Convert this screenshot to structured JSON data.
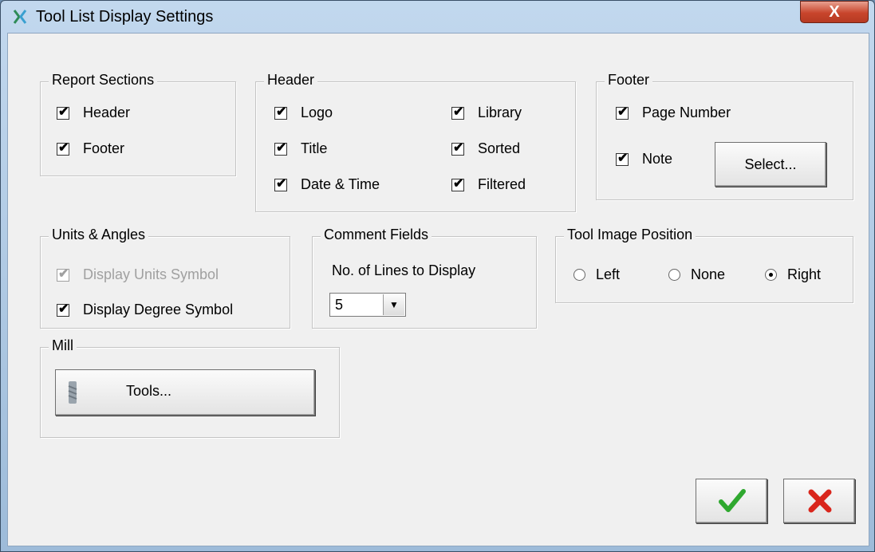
{
  "window": {
    "title": "Tool List Display Settings",
    "close_label": "X"
  },
  "report_sections": {
    "legend": "Report Sections",
    "items": [
      {
        "label": "Header",
        "checked": true
      },
      {
        "label": "Footer",
        "checked": true
      }
    ]
  },
  "header": {
    "legend": "Header",
    "items": [
      {
        "label": "Logo",
        "checked": true
      },
      {
        "label": "Title",
        "checked": true
      },
      {
        "label": "Date & Time",
        "checked": true
      },
      {
        "label": "Library",
        "checked": true
      },
      {
        "label": "Sorted",
        "checked": true
      },
      {
        "label": "Filtered",
        "checked": true
      }
    ]
  },
  "footer": {
    "legend": "Footer",
    "items": [
      {
        "label": "Page Number",
        "checked": true
      },
      {
        "label": "Note",
        "checked": true
      }
    ],
    "select_button": "Select..."
  },
  "units": {
    "legend": "Units & Angles",
    "items": [
      {
        "label": "Display Units Symbol",
        "checked": true,
        "disabled": true
      },
      {
        "label": "Display Degree Symbol",
        "checked": true
      }
    ]
  },
  "comments": {
    "legend": "Comment Fields",
    "label": "No. of Lines to Display",
    "value": "5"
  },
  "image_position": {
    "legend": "Tool Image Position",
    "options": [
      {
        "label": "Left",
        "selected": false
      },
      {
        "label": "None",
        "selected": false
      },
      {
        "label": "Right",
        "selected": true
      }
    ]
  },
  "mill": {
    "legend": "Mill",
    "tools_button": "Tools..."
  },
  "check_mark": "✔",
  "actions": {
    "ok_icon": "checkmark-icon",
    "cancel_icon": "x-icon",
    "ok_color": "#2fa82f",
    "cancel_color": "#d9261c"
  }
}
